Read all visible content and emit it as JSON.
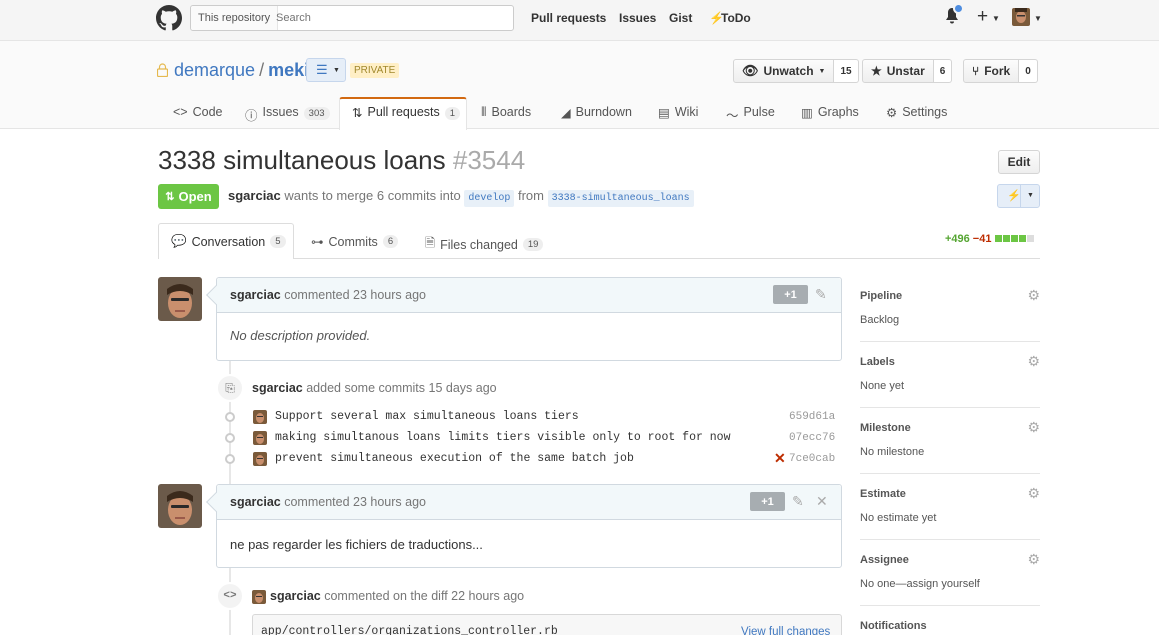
{
  "header": {
    "search_scope": "This repository",
    "search_placeholder": "Search",
    "nav": [
      "Pull requests",
      "Issues",
      "Gist",
      "ToDo"
    ]
  },
  "repo": {
    "owner": "demarque",
    "separator": "/",
    "name": "meki",
    "private_label": "PRIVATE",
    "watch": {
      "label": "Unwatch",
      "count": "15"
    },
    "star": {
      "label": "Unstar",
      "count": "6"
    },
    "fork": {
      "label": "Fork",
      "count": "0"
    },
    "tabs": [
      {
        "label": "Code",
        "count": ""
      },
      {
        "label": "Issues",
        "count": "303"
      },
      {
        "label": "Pull requests",
        "count": "1"
      },
      {
        "label": "Boards",
        "count": ""
      },
      {
        "label": "Burndown",
        "count": ""
      },
      {
        "label": "Wiki",
        "count": ""
      },
      {
        "label": "Pulse",
        "count": ""
      },
      {
        "label": "Graphs",
        "count": ""
      },
      {
        "label": "Settings",
        "count": ""
      }
    ]
  },
  "pr": {
    "title": "3338 simultaneous loans",
    "number": "#3544",
    "edit_label": "Edit",
    "state": "Open",
    "author": "sgarciac",
    "merge_text_1": "wants to merge 6 commits into",
    "base_branch": "develop",
    "from_text": "from",
    "head_branch": "3338-simultaneous_loans",
    "tabs": [
      {
        "label": "Conversation",
        "count": "5"
      },
      {
        "label": "Commits",
        "count": "6"
      },
      {
        "label": "Files changed",
        "count": "19"
      }
    ],
    "additions": "+496",
    "deletions": "−41"
  },
  "timeline": {
    "comment1": {
      "author": "sgarciac",
      "meta": "commented 23 hours ago",
      "plus1": "+1",
      "body": "No description provided."
    },
    "commits_event": {
      "author": "sgarciac",
      "meta": "added some commits 15 days ago",
      "commits": [
        {
          "message": "Support several max simultaneous loans tiers",
          "sha": "659d61a",
          "failed": false
        },
        {
          "message": "making simultanous loans limits tiers visible only to root for now",
          "sha": "07ecc76",
          "failed": false
        },
        {
          "message": "prevent simultaneous execution of the same batch job",
          "sha": "7ce0cab",
          "failed": true
        }
      ]
    },
    "comment2": {
      "author": "sgarciac",
      "meta": "commented 23 hours ago",
      "plus1": "+1",
      "body": "ne pas regarder les fichiers de traductions..."
    },
    "diff_comment": {
      "author": "sgarciac",
      "meta": "commented on the diff 22 hours ago",
      "file": "app/controllers/organizations_controller.rb",
      "link": "View full changes"
    }
  },
  "sidebar": [
    {
      "title": "Pipeline",
      "value": "Backlog"
    },
    {
      "title": "Labels",
      "value": "None yet"
    },
    {
      "title": "Milestone",
      "value": "No milestone"
    },
    {
      "title": "Estimate",
      "value": "No estimate yet"
    },
    {
      "title": "Assignee",
      "value": "No one—assign yourself"
    },
    {
      "title": "Notifications",
      "value": ""
    }
  ],
  "colors": {
    "open_green": "#6cc644",
    "link_blue": "#4078c0",
    "active_tab_orange": "#d26911",
    "fail_red": "#bd2c00"
  }
}
